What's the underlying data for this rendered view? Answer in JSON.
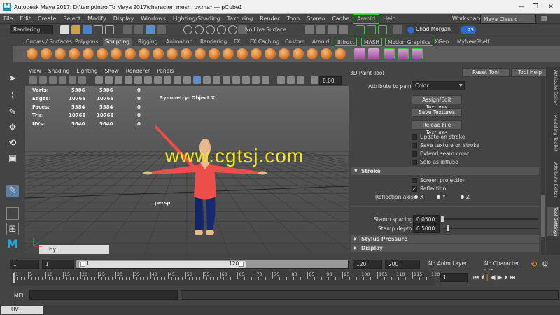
{
  "window": {
    "title": "Autodesk Maya 2017: D:\\temp\\Intro To Maya 2017\\character_mesh_uv.ma* --- pCube1",
    "app_logo": "M"
  },
  "menubar": [
    "File",
    "Edit",
    "Create",
    "Select",
    "Modify",
    "Display",
    "Windows",
    "Lighting/Shading",
    "Texturing",
    "Render",
    "Toon",
    "Stereo",
    "Cache",
    "Arnold",
    "Help"
  ],
  "workspace": {
    "label": "Workspace :",
    "value": "Maya Classic"
  },
  "statusline": {
    "mode": "Rendering",
    "live_surface": "No Live Surface",
    "user": "Chad Morgan",
    "notifications": "25"
  },
  "shelf": {
    "tabs": [
      "Curves / Surfaces",
      "Polygons",
      "Sculpting",
      "Rigging",
      "Animation",
      "Rendering",
      "FX",
      "FX Caching",
      "Custom",
      "Arnold",
      "Bifrost",
      "MASH",
      "Motion Graphics",
      "XGen",
      "MyNewShelf"
    ],
    "selected": "Sculpting"
  },
  "viewport": {
    "menu": [
      "View",
      "Shading",
      "Lighting",
      "Show",
      "Renderer",
      "Panels"
    ],
    "exposure": "0.00",
    "hud": [
      {
        "label": "Verts:",
        "a": "5386",
        "b": "5386",
        "c": "0"
      },
      {
        "label": "Edges:",
        "a": "10768",
        "b": "10768",
        "c": "0"
      },
      {
        "label": "Faces:",
        "a": "5384",
        "b": "5384",
        "c": "0"
      },
      {
        "label": "Tris:",
        "a": "10768",
        "b": "10768",
        "c": "0"
      },
      {
        "label": "UVs:",
        "a": "5640",
        "b": "5640",
        "c": "0"
      }
    ],
    "symmetry": "Symmetry: Object X",
    "camera": "persp",
    "minimized": "Hy..."
  },
  "watermark": "www.cgtsj.com",
  "tool_panel": {
    "title": "3D Paint Tool",
    "reset": "Reset Tool",
    "help": "Tool Help",
    "attribute_label": "Attribute to paint:",
    "attribute_value": "Color",
    "buttons": [
      "Assign/Edit Textures",
      "Save Textures",
      "Reload File Textures"
    ],
    "checks": [
      {
        "label": "Update on stroke",
        "checked": false
      },
      {
        "label": "Save texture on stroke",
        "checked": false
      },
      {
        "label": "Extend seam color",
        "checked": false
      },
      {
        "label": "Solo as diffuse",
        "checked": false
      }
    ],
    "stroke_section": "Stroke",
    "screen_projection": "Screen projection",
    "reflection": "Reflection",
    "reflection_axis_label": "Reflection axis:",
    "axes": [
      "X",
      "Y",
      "Z"
    ],
    "stamp_spacing_label": "Stamp spacing:",
    "stamp_spacing": "0.0500",
    "stamp_depth_label": "Stamp depth:",
    "stamp_depth": "0.5000",
    "sections": [
      "Stylus Pressure",
      "Display"
    ]
  },
  "side_tabs": [
    "Attribute Editor",
    "Modeling Toolkit",
    "Attribute Editor",
    "Tool Settings"
  ],
  "range": {
    "start": "1",
    "start2": "1",
    "slider_start": "1",
    "slider_end": "120",
    "end": "120",
    "end2": "200",
    "anim_layer": "No Anim Layer",
    "char_set": "No Character Set"
  },
  "timeline": {
    "ticks": [
      "1",
      "5",
      "10",
      "15",
      "20",
      "25",
      "30",
      "35",
      "40",
      "45",
      "50",
      "55",
      "60",
      "65",
      "70",
      "75",
      "80",
      "85",
      "90",
      "95",
      "100",
      "105",
      "110",
      "115",
      "120"
    ],
    "current": "1"
  },
  "mel": {
    "label": "MEL"
  },
  "taskbar": {
    "item": "UV..."
  }
}
